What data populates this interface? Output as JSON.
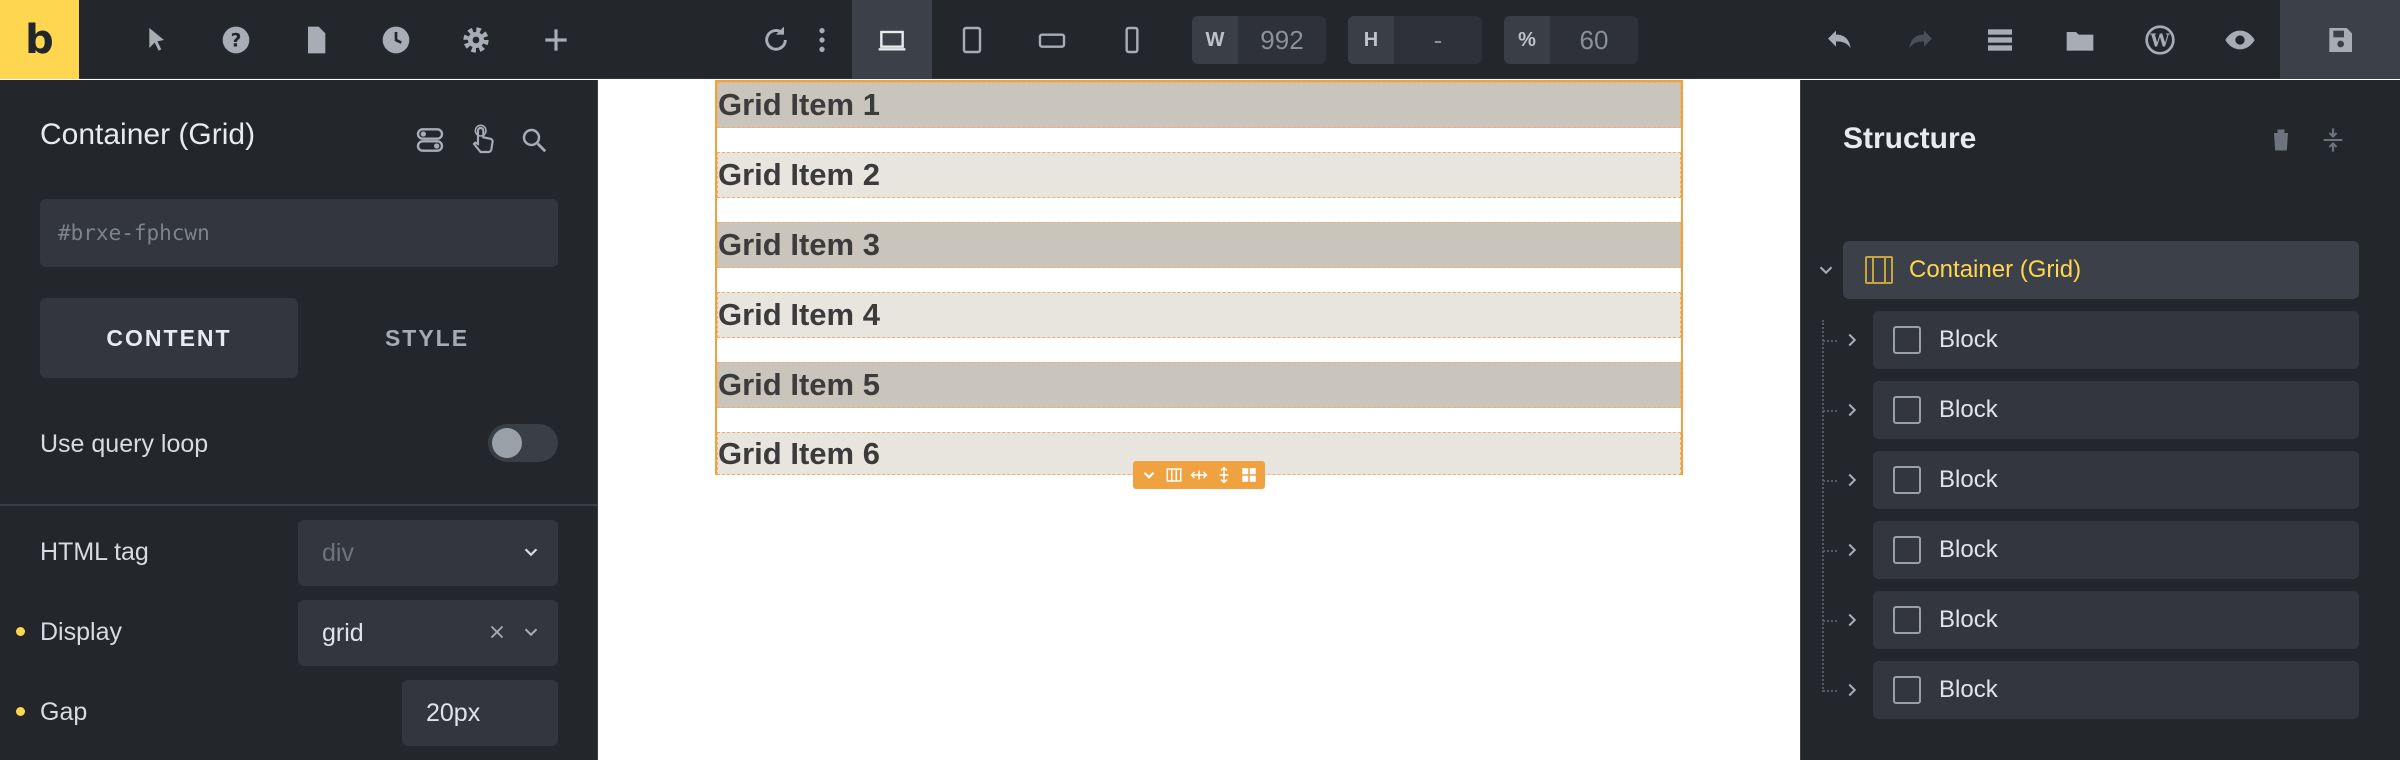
{
  "toolbar": {
    "logo": "b",
    "width_label": "W",
    "width_value": "992",
    "height_label": "H",
    "height_value": "-",
    "scale_label": "%",
    "scale_value": "60"
  },
  "left_panel": {
    "title": "Container (Grid)",
    "id_placeholder": "#brxe-fphcwn",
    "tabs": {
      "content": "CONTENT",
      "style": "STYLE"
    },
    "query_loop_label": "Use query loop",
    "html_tag_label": "HTML tag",
    "html_tag_value": "div",
    "display_label": "Display",
    "display_value": "grid",
    "gap_label": "Gap",
    "gap_value": "20px"
  },
  "canvas": {
    "grid_items": [
      "Grid Item 1",
      "Grid Item 2",
      "Grid Item 3",
      "Grid Item 4",
      "Grid Item 5",
      "Grid Item 6"
    ]
  },
  "structure": {
    "title": "Structure",
    "root_label": "Container (Grid)",
    "children": [
      "Block",
      "Block",
      "Block",
      "Block",
      "Block",
      "Block"
    ]
  },
  "colors": {
    "accent": "#ffd64f",
    "selection": "#f0a140",
    "panel_bg": "#23262b"
  }
}
